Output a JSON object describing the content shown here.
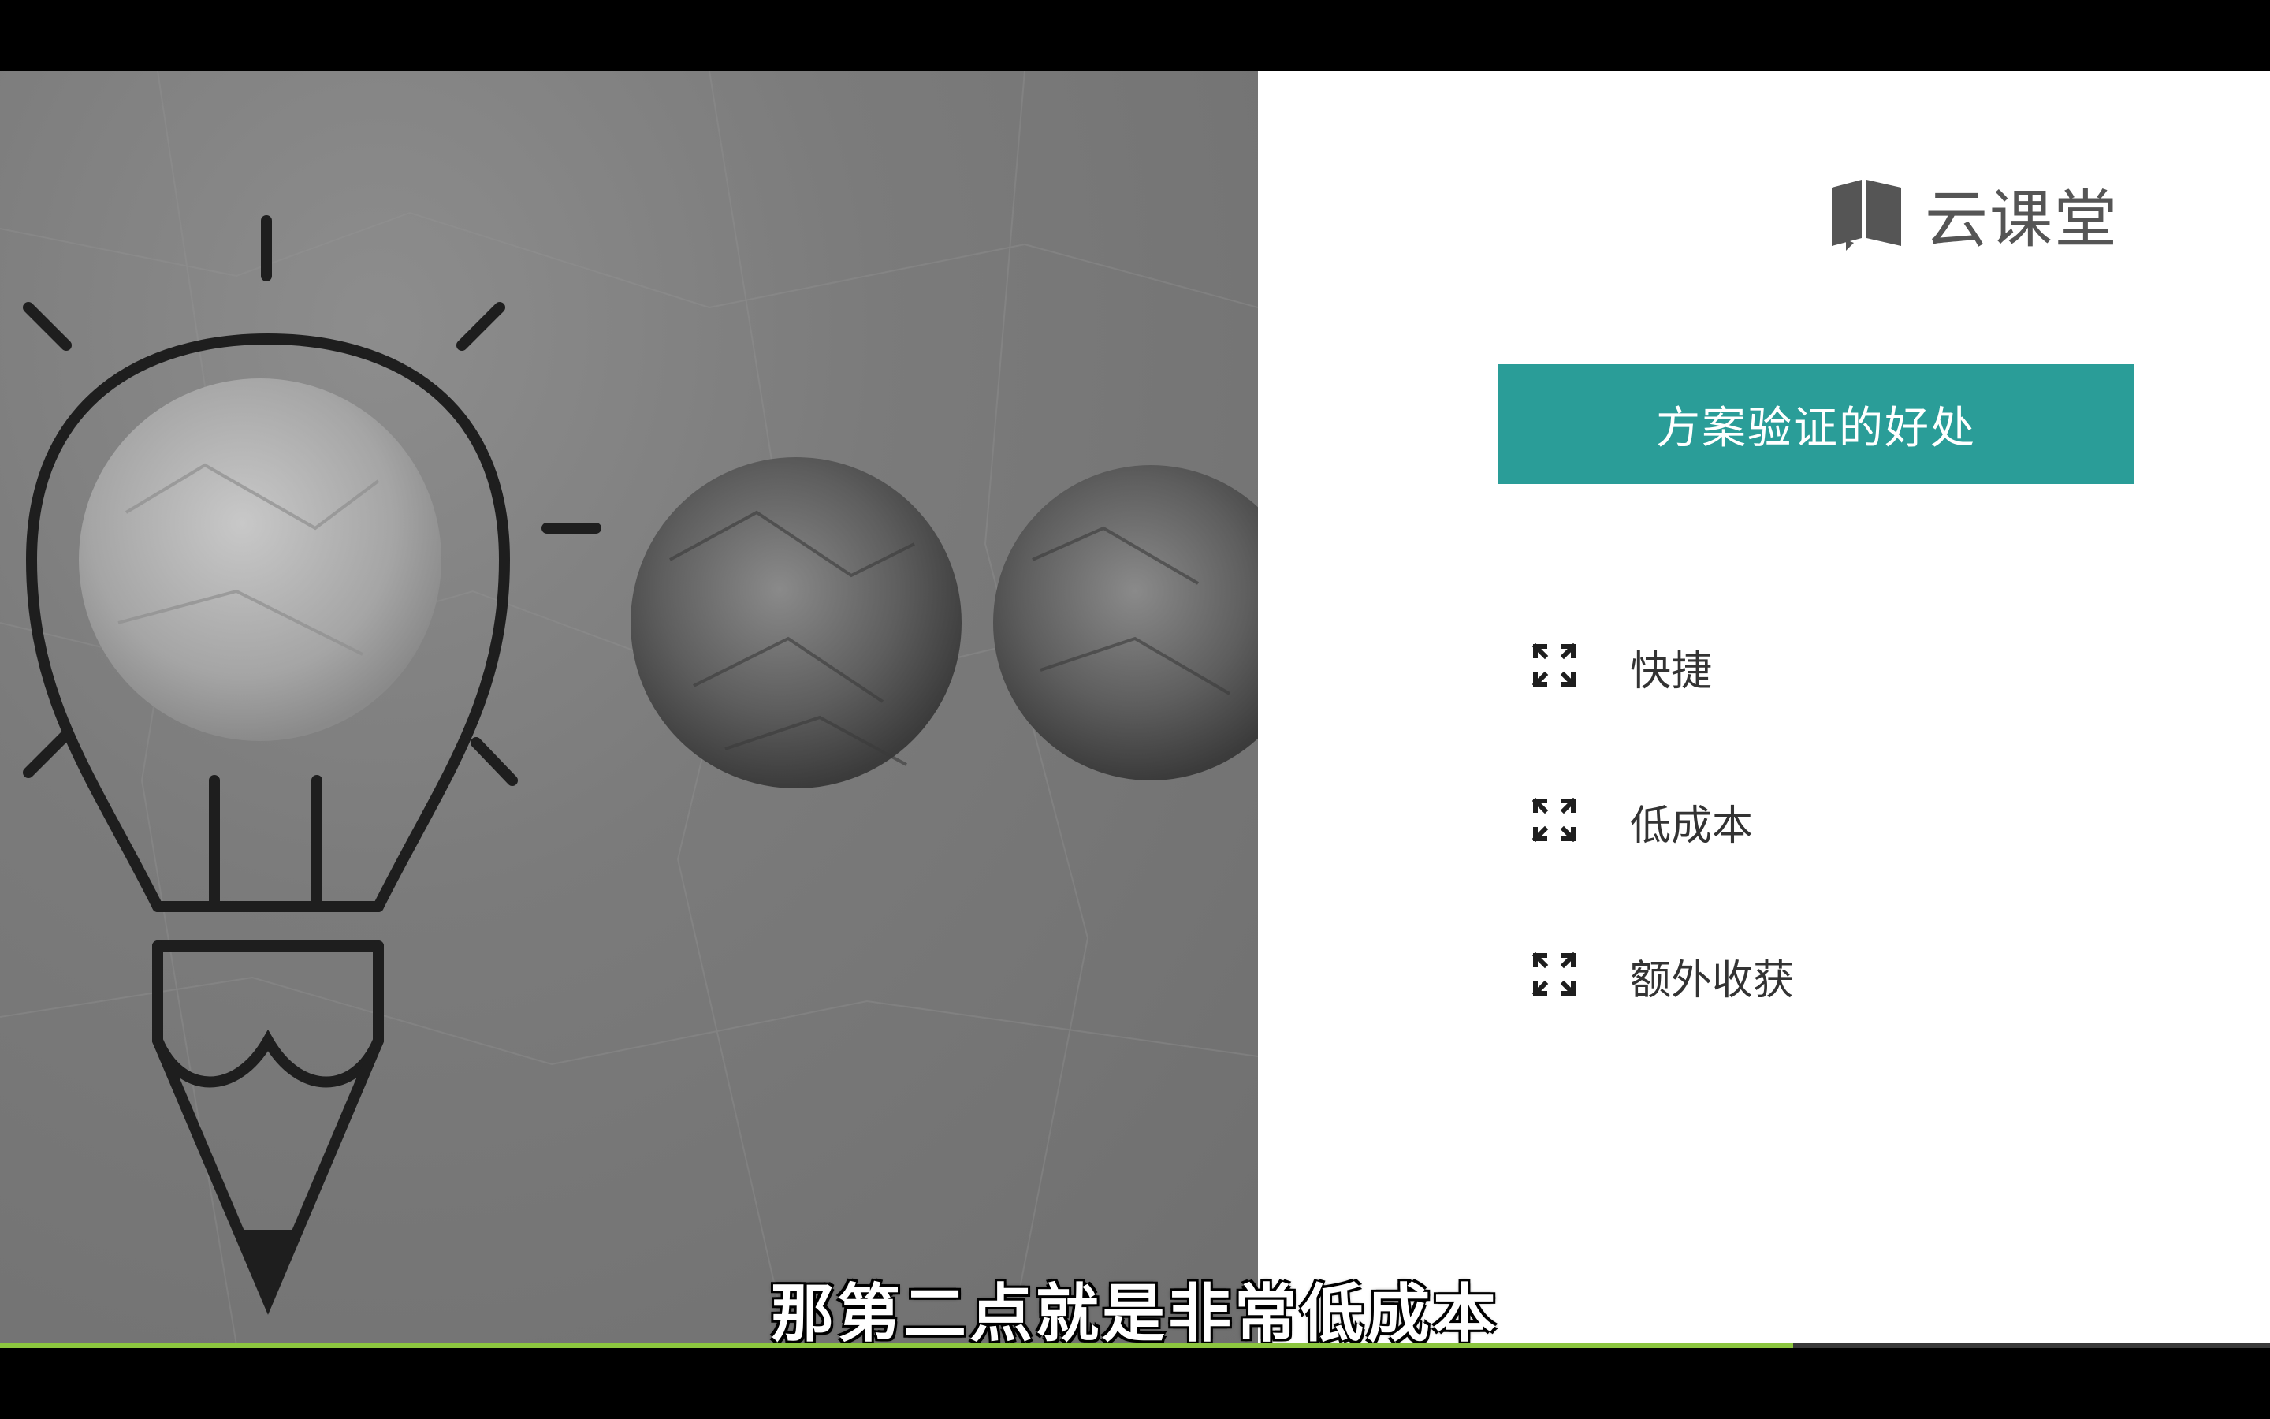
{
  "logo": {
    "text": "云课堂",
    "icon": "book-icon",
    "color": "#555555"
  },
  "slide": {
    "title": "方案验证的好处",
    "accent_color": "#2a9d98",
    "items": [
      {
        "label": "快捷",
        "icon": "expand-arrows-icon"
      },
      {
        "label": "低成本",
        "icon": "expand-arrows-icon"
      },
      {
        "label": "额外收获",
        "icon": "expand-arrows-icon"
      }
    ]
  },
  "player": {
    "subtitle": "那第二点就是非常低成本",
    "progress_fraction": 0.79,
    "progress_color": "#8cc63f"
  }
}
